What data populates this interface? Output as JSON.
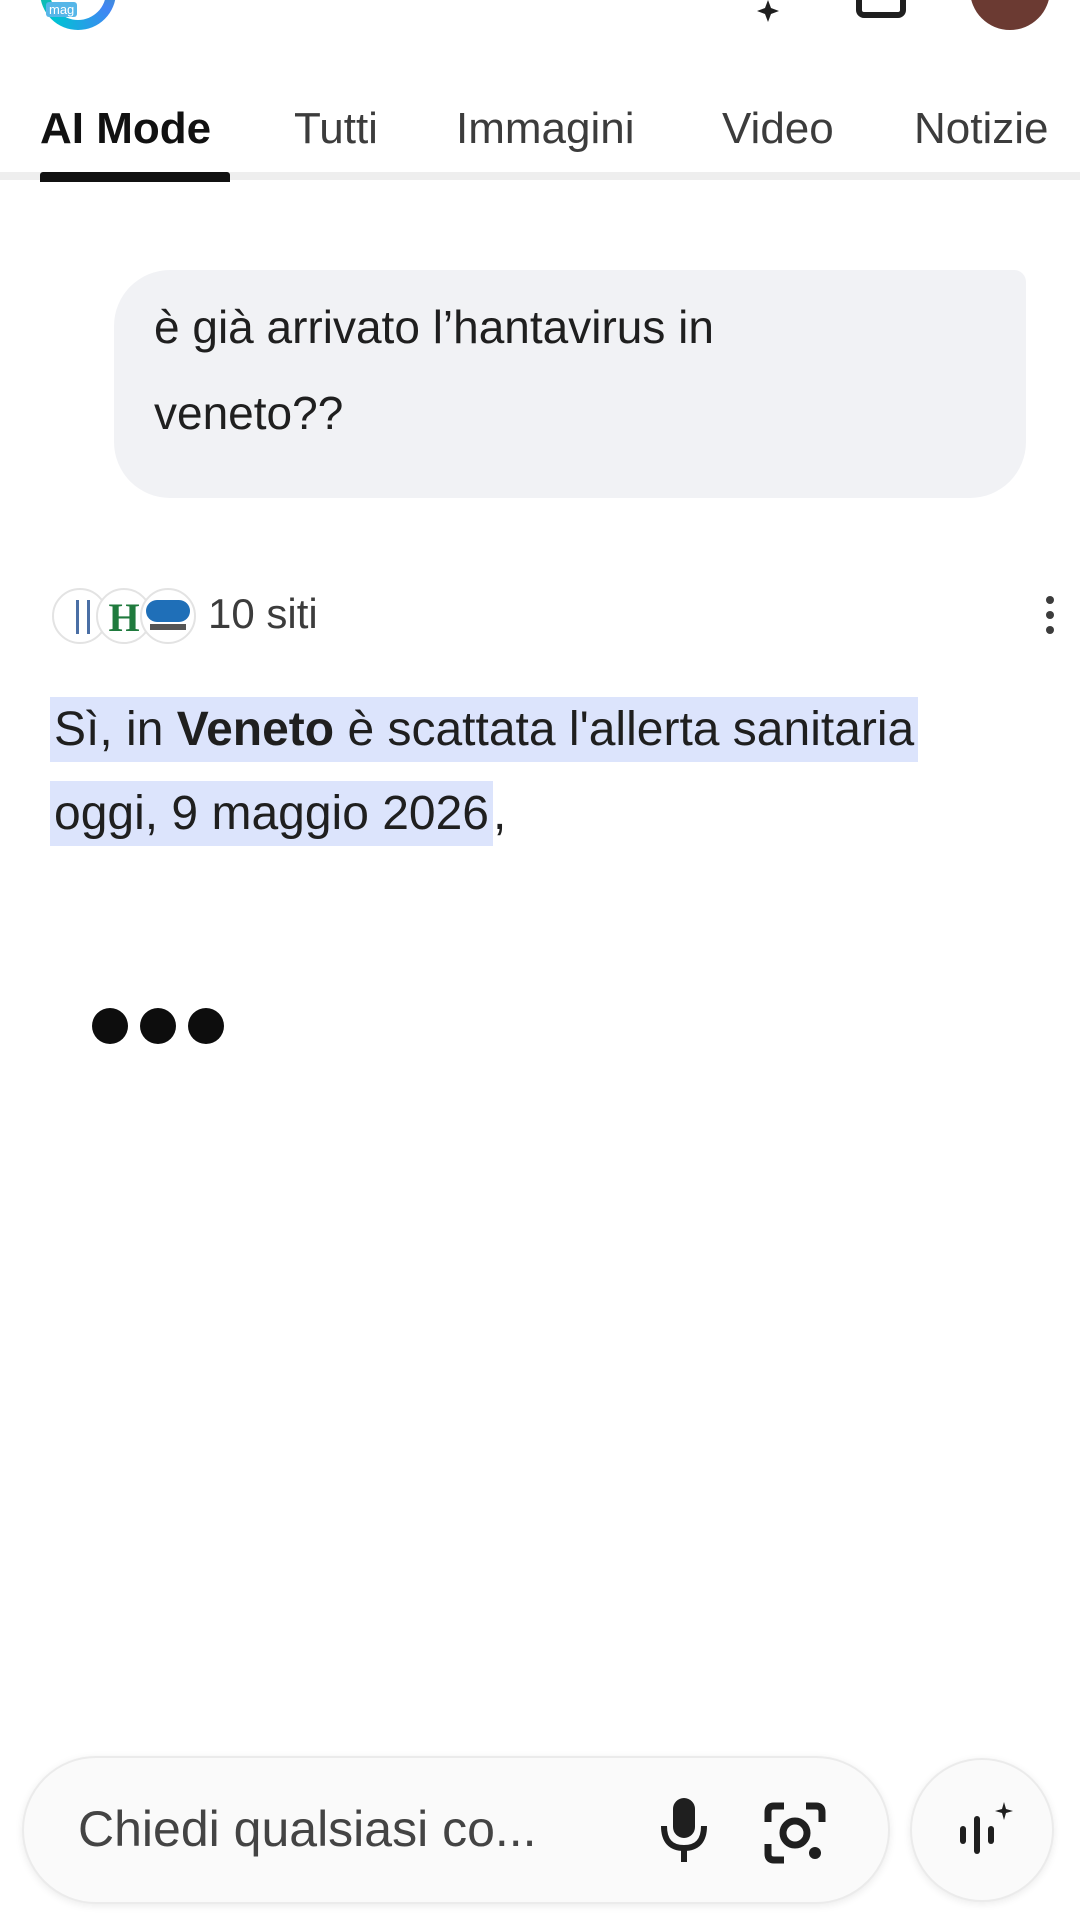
{
  "header": {
    "logo_label": "mag",
    "icons": [
      "spark-icon",
      "tab-switcher-icon",
      "avatar"
    ]
  },
  "tabs": [
    {
      "label": "AI Mode",
      "active": true
    },
    {
      "label": "Tutti",
      "active": false
    },
    {
      "label": "Immagini",
      "active": false
    },
    {
      "label": "Video",
      "active": false
    },
    {
      "label": "Notizie",
      "active": false
    }
  ],
  "query": {
    "text": "è già arrivato l’hantavirus in veneto??"
  },
  "sources": {
    "count_label": "10 siti",
    "logos": [
      "medical-source-logo",
      "h-source-logo",
      "treviso-today-logo"
    ]
  },
  "answer": {
    "part1": "Sì, in ",
    "bold": "Veneto",
    "part2": " è scattata l'allerta sanitaria oggi, 9 maggio 2026",
    "trailing": ","
  },
  "input": {
    "placeholder": "Chiedi qualsiasi co..."
  },
  "colors": {
    "highlight": "#dce4fc",
    "query_bubble": "#f1f2f5",
    "active_tab_underline": "#111111"
  }
}
